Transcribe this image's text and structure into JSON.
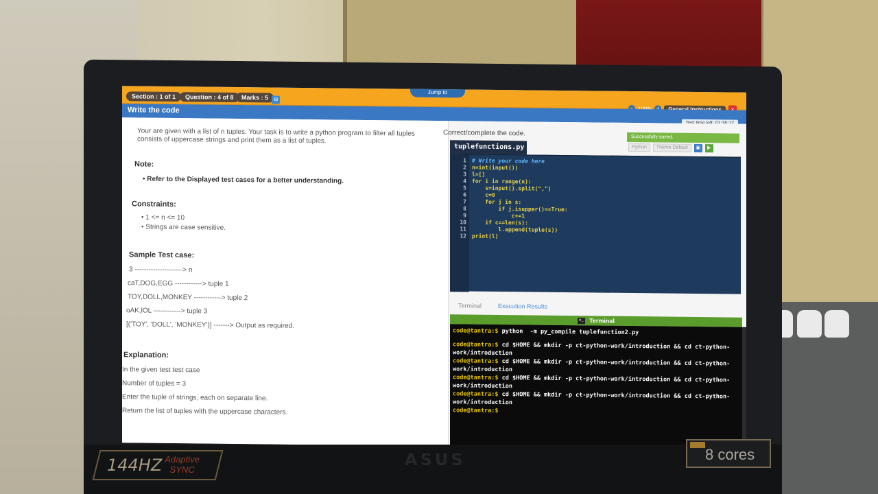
{
  "topbar": {
    "section": "Section : 1 of 1",
    "question": "Question : 4 of 8",
    "marks": "Marks : 5",
    "jump_label": "Jump to",
    "zoom": "100%",
    "general_instructions": "General Instructions",
    "close_glyph": "×"
  },
  "title": "Write the code",
  "timer": "Test time left: 01:35:17",
  "problem": {
    "intro_line1": "Your are given with a list of n tuples. Your task is to write a python program to filter all tuples",
    "intro_line2": "consists of uppercase strings and print them as a list of tuples.",
    "note_heading": "Note:",
    "note_item": "Refer to the Displayed test cases for a better understanding.",
    "constraints_heading": "Constraints:",
    "constraints": [
      "1 <= n <= 10",
      "Strings are case sensitive."
    ],
    "sample_heading": "Sample Test case:",
    "sample_lines": [
      "3 ---------------------> n",
      "caT,DOG,EGG ------------> tuple 1",
      "TOY,DOLL,MONKEY ------------> tuple 2",
      "oAK,lOL ------------> tuple 3",
      "[('TOY', 'DOLL', 'MONKEY')] -------> Output as required."
    ],
    "explanation_heading": "Explanation:",
    "explanation_lines": [
      "In the given test test case",
      "Number of tuples = 3",
      "Enter the tuple of strings, each on separate line.",
      "Return the list of tuples with the uppercase characters."
    ]
  },
  "editor": {
    "label": "Correct/complete the code.",
    "saved_message": "Successfully saved.",
    "language": "Python",
    "theme": "Theme Default",
    "file_name": "tuplefunctions.py",
    "lines": [
      {
        "n": "1",
        "code": "# Write your code here"
      },
      {
        "n": "2",
        "code": "n=int(input())"
      },
      {
        "n": "3",
        "code": "l=[]"
      },
      {
        "n": "4",
        "code": "for i in range(n):"
      },
      {
        "n": "5",
        "code": "    s=input().split(\",\")"
      },
      {
        "n": "6",
        "code": "    c=0"
      },
      {
        "n": "7",
        "code": "    for j in s:"
      },
      {
        "n": "8",
        "code": "        if j.isupper()==True:"
      },
      {
        "n": "9",
        "code": "            c+=1"
      },
      {
        "n": "10",
        "code": "    if c==len(s):"
      },
      {
        "n": "11",
        "code": "        l.append(tuple(s))"
      },
      {
        "n": "12",
        "code": "print(l)"
      }
    ]
  },
  "tabs": {
    "terminal": "Terminal",
    "results": "Execution Results"
  },
  "terminal": {
    "title": "Terminal",
    "host": "code@tantra:$",
    "lines": [
      {
        "cmd": " python  -m py_compile tuplefunction2.py"
      },
      {
        "cmd": ""
      },
      {
        "cmd": " cd $HOME && mkdir -p ct-python-work/introduction && cd ct-python-work/introduction"
      },
      {
        "cmd": " cd $HOME && mkdir -p ct-python-work/introduction && cd ct-python-work/introduction"
      },
      {
        "cmd": " cd $HOME && mkdir -p ct-python-work/introduction && cd ct-python-work/introduction"
      },
      {
        "cmd": " cd $HOME && mkdir -p ct-python-work/introduction && cd ct-python-work/introduction"
      },
      {
        "cmd": ""
      }
    ]
  },
  "hardware": {
    "refresh": "144HZ",
    "adaptive": "Adaptive",
    "sync": "SYNC",
    "brand": "ASUS",
    "cores": "8 cores"
  }
}
